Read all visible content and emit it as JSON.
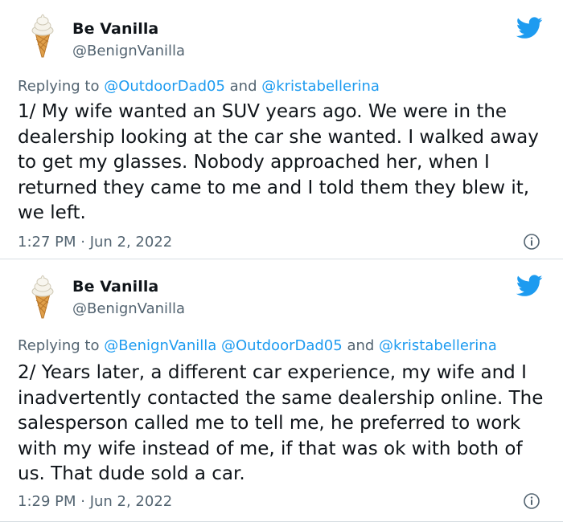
{
  "tweets": [
    {
      "display_name": "Be Vanilla",
      "handle": "@BenignVanilla",
      "replying_prefix": "Replying to ",
      "reply_mentions": [
        "@OutdoorDad05"
      ],
      "reply_joiner": " and ",
      "reply_last": "@kristabellerina",
      "text": "1/ My wife wanted an SUV years ago. We were in the dealership looking at the car she wanted. I walked away to get my glasses. Nobody approached her, when I returned they came to me and I told them they blew it, we left.",
      "timestamp": "1:27 PM · Jun 2, 2022"
    },
    {
      "display_name": "Be Vanilla",
      "handle": "@BenignVanilla",
      "replying_prefix": "Replying to ",
      "reply_mentions": [
        "@BenignVanilla",
        "@OutdoorDad05"
      ],
      "reply_joiner": " and ",
      "reply_last": "@kristabellerina",
      "text": "2/ Years later, a different car experience, my wife and I inadvertently contacted the same dealership online. The salesperson called me to tell me, he preferred to work with my wife instead of me, if that was ok with both of us. That dude sold a car.",
      "timestamp": "1:29 PM · Jun 2, 2022"
    }
  ],
  "icons": {
    "avatar": "ice-cream-cone-icon",
    "brand": "twitter-bird-icon",
    "info": "info-icon"
  },
  "colors": {
    "brand_blue": "#1d9bf0",
    "secondary_text": "#536471",
    "primary_text": "#0f1419",
    "divider": "#d7dde2"
  }
}
